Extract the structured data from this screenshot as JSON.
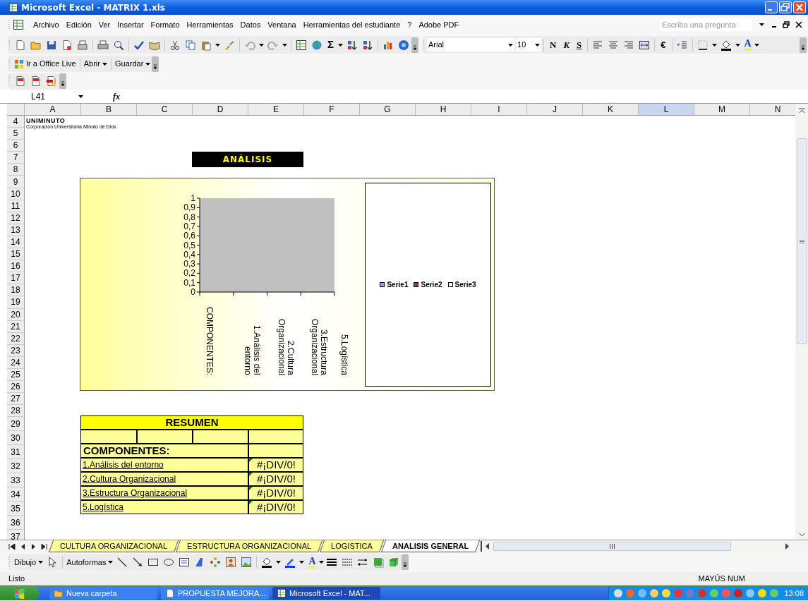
{
  "window": {
    "title": "Microsoft Excel - MATRIX 1.xls"
  },
  "menu": [
    "Archivo",
    "Edición",
    "Ver",
    "Insertar",
    "Formato",
    "Herramientas",
    "Datos",
    "Ventana",
    "Herramientas del estudiante",
    "?",
    "Adobe PDF"
  ],
  "help_search": {
    "placeholder": "Escriba una pregunta"
  },
  "standard_toolbar": {
    "autosum": "Σ"
  },
  "formatting_toolbar": {
    "font": "Arial",
    "size": "10",
    "bold": "N",
    "italic": "K",
    "underline": "S",
    "currency": "€",
    "font_color": "A"
  },
  "office_live_toolbar": [
    {
      "label": "Ir a Office Live",
      "dropdown": false
    },
    {
      "label": "Abrir",
      "dropdown": true
    },
    {
      "label": "Guardar",
      "dropdown": true
    }
  ],
  "formula_bar": {
    "name_box": "L41",
    "function_label": "fx"
  },
  "columns": [
    {
      "label": "A",
      "selected": false
    },
    {
      "label": "B",
      "selected": false
    },
    {
      "label": "C",
      "selected": false
    },
    {
      "label": "D",
      "selected": false
    },
    {
      "label": "E",
      "selected": false
    },
    {
      "label": "F",
      "selected": false
    },
    {
      "label": "G",
      "selected": false
    },
    {
      "label": "H",
      "selected": false
    },
    {
      "label": "I",
      "selected": false
    },
    {
      "label": "J",
      "selected": false
    },
    {
      "label": "K",
      "selected": false
    },
    {
      "label": "L",
      "selected": true
    },
    {
      "label": "M",
      "selected": false
    },
    {
      "label": "N",
      "selected": false
    }
  ],
  "rows": [
    "4",
    "5",
    "6",
    "7",
    "8",
    "9",
    "10",
    "11",
    "12",
    "13",
    "14",
    "15",
    "16",
    "17",
    "18",
    "19",
    "20",
    "21",
    "22",
    "23",
    "24",
    "25",
    "26",
    "27",
    "28",
    "29",
    "30",
    "31",
    "32",
    "33",
    "34",
    "35",
    "36",
    "37"
  ],
  "logo": {
    "name": "UNIMINUTO",
    "tagline": "Corporación Universitaria Minuto de Dios"
  },
  "heading": "ANÁLISIS",
  "chart": {
    "first_category_separator": ":",
    "chart_data": {
      "type": "bar",
      "categories": [
        "COMPONENTES",
        "1.Análisis del entorno",
        "2.Cultura Organizacional",
        "3.Estructura Organizacional",
        "5.Logística"
      ],
      "series": [
        {
          "name": "Serie1",
          "color": "#9999ff",
          "values": [
            null,
            null,
            null,
            null,
            null
          ]
        },
        {
          "name": "Serie2",
          "color": "#993366",
          "values": [
            null,
            null,
            null,
            null,
            null
          ]
        },
        {
          "name": "Serie3",
          "color": "#ffffcc",
          "values": [
            null,
            null,
            null,
            null,
            null
          ]
        }
      ],
      "ylim": [
        0,
        1
      ],
      "yticks": [
        {
          "value": 0,
          "label": "0"
        },
        {
          "value": 0.1,
          "label": "0,1"
        },
        {
          "value": 0.2,
          "label": "0,2"
        },
        {
          "value": 0.3,
          "label": "0,3"
        },
        {
          "value": 0.4,
          "label": "0,4"
        },
        {
          "value": 0.5,
          "label": "0,5"
        },
        {
          "value": 0.6,
          "label": "0,6"
        },
        {
          "value": 0.7,
          "label": "0,7"
        },
        {
          "value": 0.8,
          "label": "0,8"
        },
        {
          "value": 0.9,
          "label": "0,9"
        },
        {
          "value": 1,
          "label": "1"
        }
      ]
    }
  },
  "summary": {
    "title": "RESUMEN",
    "header": "COMPONENTES:",
    "items": [
      {
        "label": "1.Análisis del entorno",
        "value": "#¡DIV/0!"
      },
      {
        "label": "2.Cultura Organizacional",
        "value": "#¡DIV/0!"
      },
      {
        "label": "3.Estructura Organizacional",
        "value": "#¡DIV/0!"
      },
      {
        "label": "5.Logística",
        "value": "#¡DIV/0!"
      }
    ]
  },
  "sheet_tabs": [
    {
      "label": "CULTURA ORGANIZACIONAL",
      "selected": false
    },
    {
      "label": "ESTRUCTURA ORGANIZACIONAL",
      "selected": false
    },
    {
      "label": "LOGISTICA",
      "selected": false
    },
    {
      "label": "ANALISIS GENERAL",
      "selected": true
    }
  ],
  "drawing_toolbar": {
    "draw": "Dibujo",
    "autoshapes": "Autoformas",
    "font_color": "A"
  },
  "status_bar": {
    "left": "Listo",
    "indicators": "MAYÚS NUM"
  },
  "taskbar": {
    "tasks": [
      {
        "label": "Nueva carpeta",
        "selected": false,
        "kind": "folder"
      },
      {
        "label": "PROPUESTA MEJORA...",
        "selected": false,
        "kind": "document"
      },
      {
        "label": "Microsoft Excel - MAT...",
        "selected": true,
        "kind": "spreadsheet"
      }
    ],
    "clock": "13:08"
  }
}
